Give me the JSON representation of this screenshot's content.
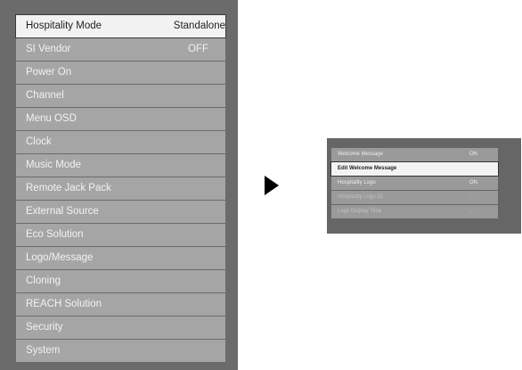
{
  "main_menu": {
    "items": [
      {
        "label": "Hospitality Mode",
        "value": "Standalone"
      },
      {
        "label": "SI Vendor",
        "value": "OFF"
      },
      {
        "label": "Power On"
      },
      {
        "label": "Channel"
      },
      {
        "label": "Menu OSD"
      },
      {
        "label": "Clock"
      },
      {
        "label": "Music Mode"
      },
      {
        "label": "Remote Jack Pack"
      },
      {
        "label": "External Source"
      },
      {
        "label": "Eco Solution"
      },
      {
        "label": "Logo/Message"
      },
      {
        "label": "Cloning"
      },
      {
        "label": "REACH Solution"
      },
      {
        "label": "Security"
      },
      {
        "label": "System"
      }
    ]
  },
  "arrow_icon": "right-triangle-icon",
  "sub_menu": {
    "items": [
      {
        "label": "Welcome Message",
        "value": "ON"
      },
      {
        "label": "Edit Welcome Message"
      },
      {
        "label": "Hospitality Logo",
        "value": "ON"
      },
      {
        "label": "Hospitality Logo DL",
        "value": "..."
      },
      {
        "label": "Logo Display Time",
        "value": "..."
      }
    ]
  }
}
